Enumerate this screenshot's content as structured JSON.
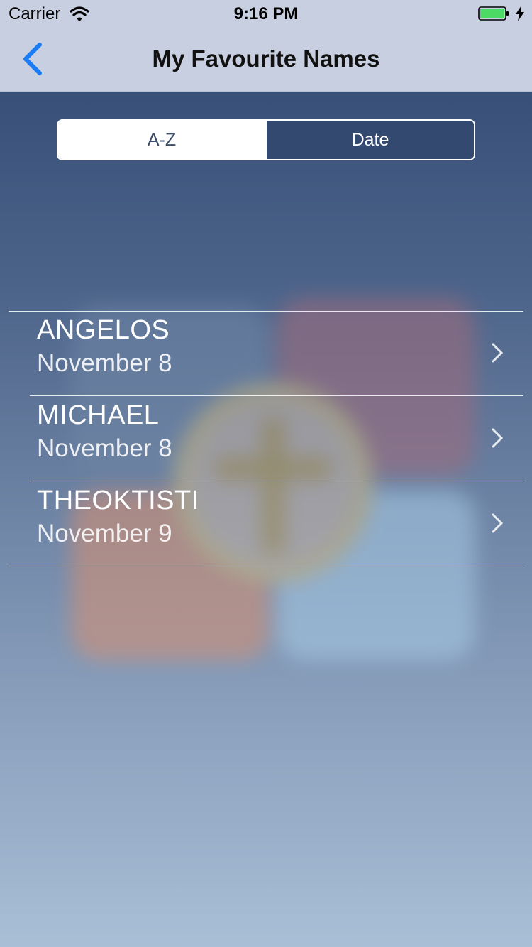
{
  "status": {
    "carrier": "Carrier",
    "time": "9:16 PM"
  },
  "nav": {
    "title": "My Favourite Names",
    "back_icon": "chevron-left-icon"
  },
  "segment": {
    "options": [
      "A-Z",
      "Date"
    ],
    "selected": "A-Z"
  },
  "names": [
    {
      "name": "ANGELOS",
      "date": "November 8"
    },
    {
      "name": "MICHAEL",
      "date": "November 8"
    },
    {
      "name": "THEOKTISTI",
      "date": "November 9"
    }
  ],
  "colors": {
    "accent": "#1a7cf5",
    "nav_background": "#c8cfe0",
    "segment_selected": "#ffffff",
    "segment_unselected": "#33496f"
  }
}
